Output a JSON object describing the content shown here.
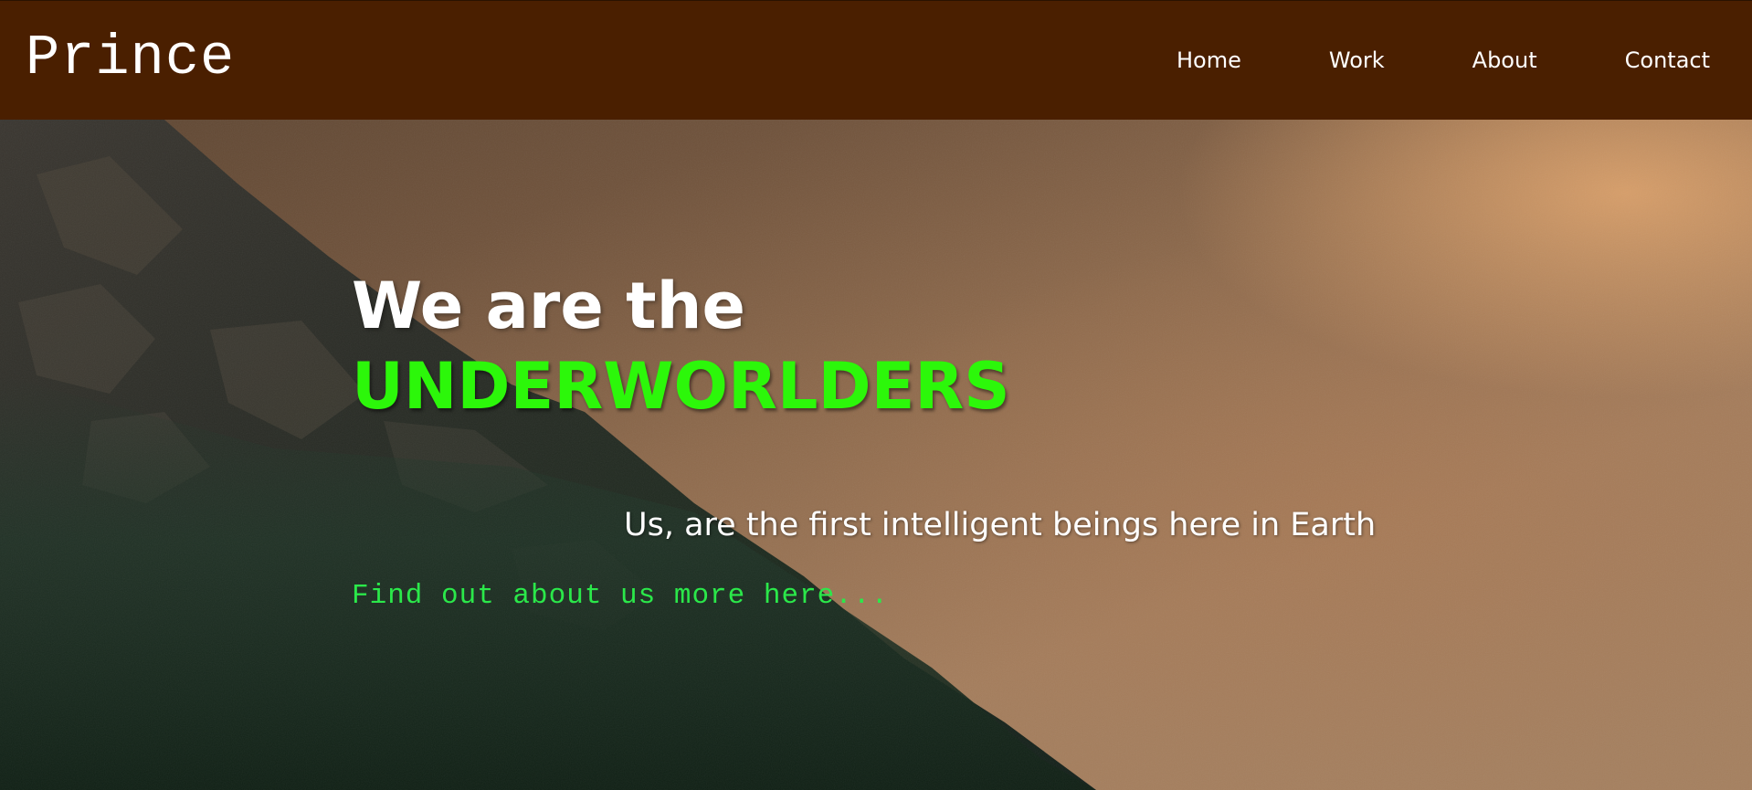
{
  "header": {
    "brand": "Prince",
    "nav": [
      {
        "label": "Home"
      },
      {
        "label": "Work"
      },
      {
        "label": "About"
      },
      {
        "label": "Contact"
      }
    ]
  },
  "hero": {
    "title_line1": "We are the",
    "title_highlight": "UNDERWORLDERS",
    "subtitle": "Us, are the first intelligent beings here in Earth",
    "cta": "Find out about us more here..."
  },
  "colors": {
    "navbar_bg": "#4a1f00",
    "highlight": "#2cf70a",
    "cta": "#2be84a",
    "text": "#ffffff"
  }
}
